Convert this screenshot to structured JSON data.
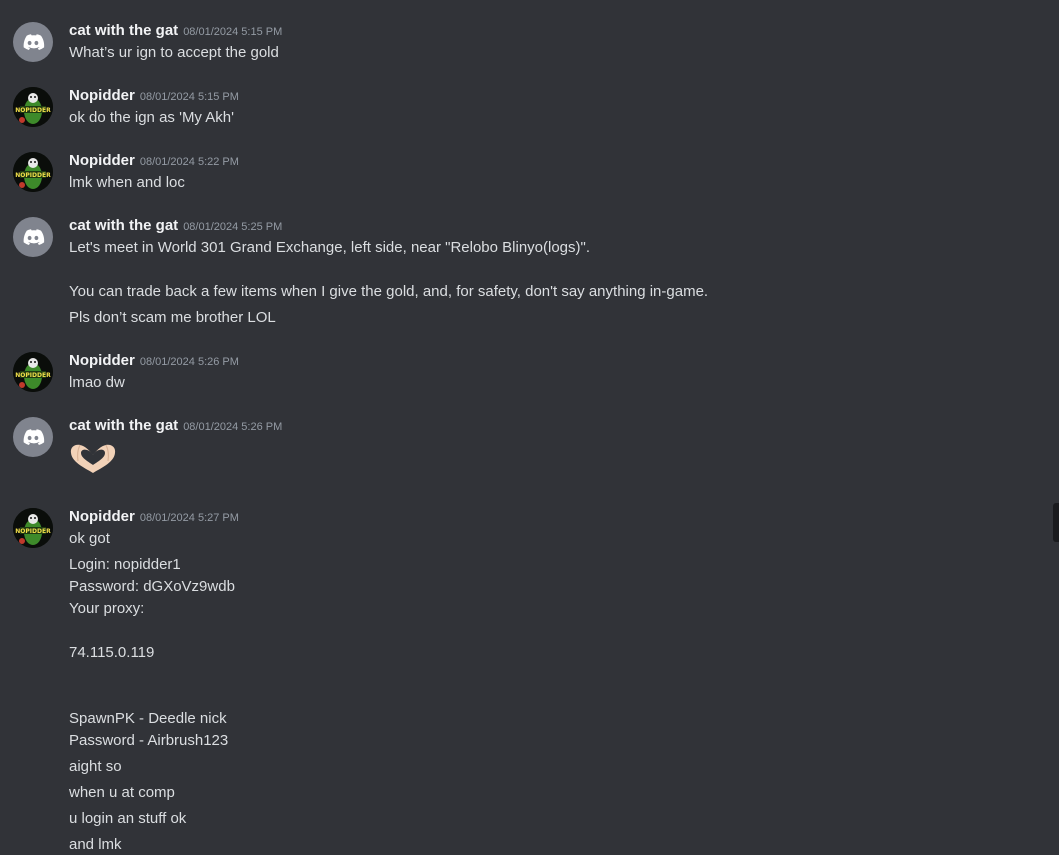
{
  "users": {
    "cat": "cat with the gat",
    "nop": "Nopidder"
  },
  "avatars": {
    "cat_icon": "discord-icon",
    "nop_icon": "nopidder-avatar-icon"
  },
  "messages": [
    {
      "author": "cat with the gat",
      "timestamp": "08/01/2024 5:15 PM",
      "lines": [
        "What’s ur ign to accept the gold"
      ]
    },
    {
      "author": "Nopidder",
      "timestamp": "08/01/2024 5:15 PM",
      "lines": [
        "ok do the ign as 'My Akh'"
      ]
    },
    {
      "author": "Nopidder",
      "timestamp": "08/01/2024 5:22 PM",
      "lines": [
        "lmk when and loc"
      ]
    },
    {
      "author": "cat with the gat",
      "timestamp": "08/01/2024 5:25 PM",
      "lines": [
        "Let's meet in World 301 Grand Exchange, left side, near \"Relobo Blinyo(logs)\".",
        "You can trade back a few items when I give the gold, and, for safety, don't say anything in-game.",
        "Pls don’t scam me brother LOL"
      ]
    },
    {
      "author": "Nopidder",
      "timestamp": "08/01/2024 5:26 PM",
      "lines": [
        "lmao dw"
      ]
    },
    {
      "author": "cat with the gat",
      "timestamp": "08/01/2024 5:26 PM",
      "lines": [],
      "emoji": "heart-hands-icon"
    },
    {
      "author": "Nopidder",
      "timestamp": "08/01/2024 5:27 PM",
      "lines": [
        "ok got",
        "Login: nopidder1",
        "Password: dGXoVz9wdb",
        "Your proxy:",
        "74.115.0.119",
        "SpawnPK - Deedle nick",
        "Password - Airbrush123",
        "aight so",
        "when u at comp",
        "u login an stuff ok",
        "and lmk"
      ]
    }
  ]
}
